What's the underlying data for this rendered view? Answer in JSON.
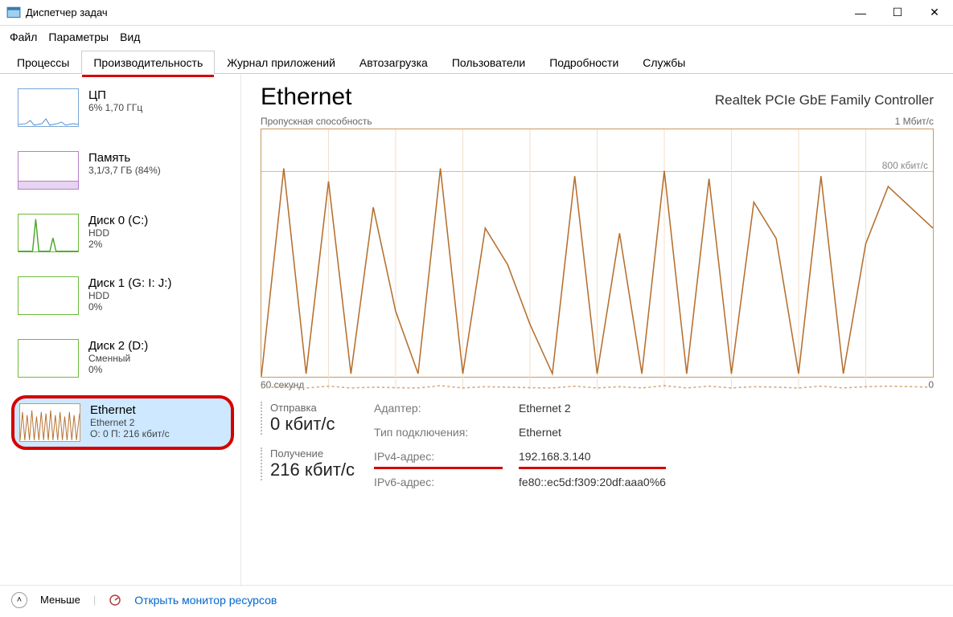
{
  "window": {
    "title": "Диспетчер задач",
    "min_label": "—",
    "max_label": "☐",
    "close_label": "✕"
  },
  "menu": {
    "file": "Файл",
    "options": "Параметры",
    "view": "Вид"
  },
  "tabs": {
    "processes": "Процессы",
    "performance": "Производительность",
    "apphistory": "Журнал приложений",
    "startup": "Автозагрузка",
    "users": "Пользователи",
    "details": "Подробности",
    "services": "Службы"
  },
  "sidebar": {
    "cpu": {
      "name": "ЦП",
      "sub": "6% 1,70 ГГц"
    },
    "memory": {
      "name": "Память",
      "sub": "3,1/3,7 ГБ (84%)"
    },
    "disk0": {
      "name": "Диск 0 (C:)",
      "sub": "HDD",
      "sub2": "2%"
    },
    "disk1": {
      "name": "Диск 1 (G: I: J:)",
      "sub": "HDD",
      "sub2": "0%"
    },
    "disk2": {
      "name": "Диск 2 (D:)",
      "sub": "Сменный",
      "sub2": "0%"
    },
    "eth": {
      "name": "Ethernet",
      "sub": "Ethernet 2",
      "sub2": "О: 0 П: 216 кбит/с"
    }
  },
  "main": {
    "title": "Ethernet",
    "adapter_name": "Realtek PCIe GbE Family Controller",
    "chart_label": "Пропускная способность",
    "ymax_label": "1 Мбит/с",
    "guide_label": "800 кбит/с",
    "x_left": "60 секунд",
    "x_right": "0"
  },
  "stats": {
    "send_label": "Отправка",
    "send_val": "0 кбит/с",
    "recv_label": "Получение",
    "recv_val": "216 кбит/с",
    "adapter_k": "Адаптер:",
    "adapter_v": "Ethernet 2",
    "type_k": "Тип подключения:",
    "type_v": "Ethernet",
    "ipv4_k": "IPv4-адрес:",
    "ipv4_v": "192.168.3.140",
    "ipv6_k": "IPv6-адрес:",
    "ipv6_v": "fe80::ec5d:f309:20df:aaa0%6"
  },
  "footer": {
    "less": "Меньше",
    "resmon": "Открыть монитор ресурсов"
  },
  "chart_data": {
    "type": "line",
    "title": "Пропускная способность",
    "xlabel": "60 секунд → 0",
    "ylabel": "кбит/с",
    "ylim": [
      0,
      1000
    ],
    "x": [
      60,
      58,
      56,
      54,
      52,
      50,
      48,
      46,
      44,
      42,
      40,
      38,
      36,
      34,
      32,
      30,
      28,
      26,
      24,
      22,
      20,
      18,
      16,
      14,
      12,
      10,
      8,
      6,
      4,
      2,
      0
    ],
    "series": [
      {
        "name": "Получение",
        "values": [
          50,
          850,
          60,
          800,
          60,
          700,
          300,
          60,
          850,
          60,
          620,
          480,
          250,
          60,
          820,
          60,
          600,
          60,
          840,
          60,
          810,
          60,
          720,
          580,
          60,
          820,
          60,
          560,
          780,
          700,
          620
        ]
      },
      {
        "name": "Отправка",
        "values": [
          5,
          10,
          5,
          12,
          5,
          8,
          6,
          5,
          14,
          5,
          10,
          8,
          6,
          5,
          12,
          5,
          10,
          5,
          14,
          5,
          12,
          5,
          10,
          8,
          5,
          12,
          5,
          10,
          12,
          10,
          8
        ]
      }
    ]
  }
}
